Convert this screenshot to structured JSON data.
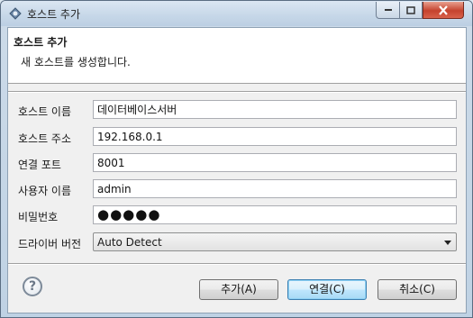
{
  "window": {
    "title": "호스트 추가",
    "app_icon": "eclipse-icon"
  },
  "header": {
    "title": "호스트 추가",
    "description": "새 호스트를 생성합니다."
  },
  "form": {
    "host_name": {
      "label": "호스트 이름",
      "value": "데이터베이스서버"
    },
    "host_address": {
      "label": "호스트 주소",
      "value": "192.168.0.1"
    },
    "port": {
      "label": "연결 포트",
      "value": "8001"
    },
    "username": {
      "label": "사용자 이름",
      "value": "admin"
    },
    "password": {
      "label": "비밀번호",
      "masked_value": "●●●●●"
    },
    "driver_version": {
      "label": "드라이버 버전",
      "selected": "Auto Detect"
    }
  },
  "buttons": {
    "help_icon": "help-icon",
    "help_glyph": "?",
    "add": "추가(A)",
    "connect": "연결(C)",
    "cancel": "취소(C)"
  }
}
